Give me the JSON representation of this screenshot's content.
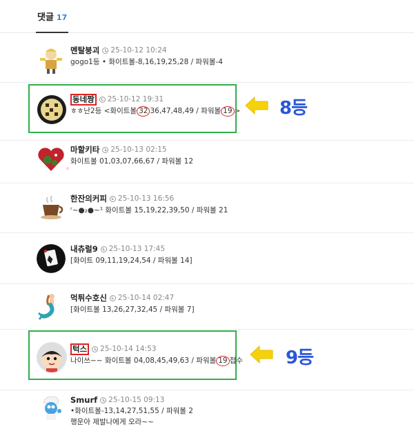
{
  "tab": {
    "label": "댓글",
    "count": "17"
  },
  "comments": [
    {
      "name": "멘탈붕괴",
      "date": "25-10-12 10:24",
      "text": "gogo1등 • 화이트볼-8,16,19,25,28 / 파워볼-4",
      "avatar": "cartoon-character-icon"
    },
    {
      "name": "동네짱",
      "date": "25-10-12 19:31",
      "text_a": "ㅎㅎ난2등 <화이트볼",
      "circle1": "32",
      "text_b": "36,47,48,49 / 파워볼",
      "circle2": "19",
      "text_c": ">",
      "avatar": "cookie-icon"
    },
    {
      "name": "마할키타",
      "date": "25-10-13 02:15",
      "text": "화이트볼 01,03,07,66,67 / 파워볼 12",
      "extra": "◦",
      "avatar": "heart-icon"
    },
    {
      "name": "한잔의커피",
      "date": "25-10-13 16:56",
      "text": "ʳ~●₂●~¹ 화이트볼 15,19,22,39,50 / 파워볼 21",
      "avatar": "coffee-cup-icon"
    },
    {
      "name": "내츄럴9",
      "date": "25-10-13 17:45",
      "text": "[화이트 09,11,19,24,54 / 파워볼 14]",
      "avatar": "playing-card-icon"
    },
    {
      "name": "먹튀수호신",
      "date": "25-10-14 02:47",
      "text": "[화이트볼 13,26,27,32,45 / 파워볼 7]",
      "avatar": "mermaid-icon"
    },
    {
      "name": "턱스",
      "date": "25-10-14 14:53",
      "text_a": "나이쓰~~ 화이트볼 04,08,45,49,63 / 파워볼 ",
      "circle2": "19",
      "text_c": " 접수",
      "avatar": "cartoon-boy-icon"
    },
    {
      "name": "Smurf",
      "date": "25-10-15 09:13",
      "text": "•화이트볼-13,14,27,51,55 / 파워볼 2",
      "text2": "행운아 제발나에게 오라~~",
      "avatar": "smurf-icon"
    }
  ],
  "annotations": {
    "rank1": "8등",
    "rank2": "9등",
    "box_color": "#2fae4a",
    "circle_color": "#e02020",
    "arrow_color": "#f5d20a",
    "rank_color": "#2a56d8"
  }
}
